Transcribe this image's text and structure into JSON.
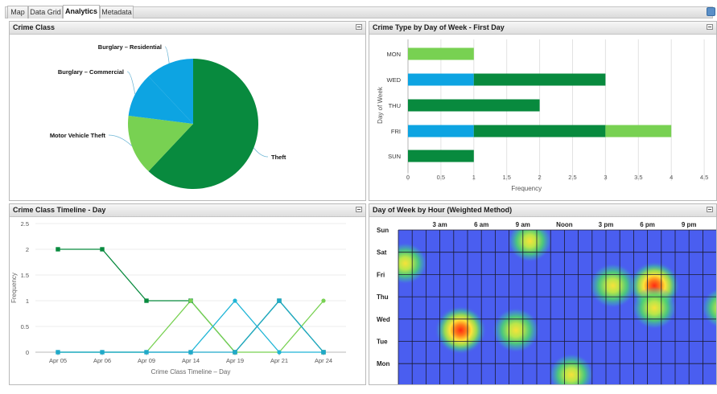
{
  "tabs": [
    {
      "label": "Map"
    },
    {
      "label": "Data Grid"
    },
    {
      "label": "Analytics"
    },
    {
      "label": "Metadata"
    }
  ],
  "panels": {
    "crime_class": {
      "title": "Crime Class"
    },
    "crime_type_day": {
      "title": "Crime Type by Day of Week - First Day"
    },
    "timeline": {
      "title": "Crime Class Timeline - Day"
    },
    "heatmap": {
      "title": "Day of Week by Hour (Weighted Method)"
    }
  },
  "colors": {
    "theft": "#088a3e",
    "motor_vehicle_theft": "#78d152",
    "burglary_commercial": "#0da4e2",
    "burglary_residential": "#0da4e2",
    "light_blue": "#1fb5d6"
  },
  "chart_data": [
    {
      "type": "pie",
      "slices": [
        {
          "label": "Theft",
          "value": 62,
          "color": "#088a3e"
        },
        {
          "label": "Motor Vehicle Theft",
          "value": 15,
          "color": "#78d152"
        },
        {
          "label": "Burglary – Commercial",
          "value": 11,
          "color": "#0da4e2"
        },
        {
          "label": "Burglary – Residential",
          "value": 12,
          "color": "#0da4e2"
        }
      ]
    },
    {
      "type": "bar",
      "orientation": "horizontal",
      "stacked": true,
      "categories": [
        "MON",
        "WED",
        "THU",
        "FRI",
        "SUN"
      ],
      "series": [
        {
          "values": [
            0,
            1,
            0,
            1,
            0
          ],
          "color": "#0da4e2"
        },
        {
          "values": [
            0,
            2,
            2,
            2,
            1
          ],
          "color": "#088a3e"
        },
        {
          "values": [
            1,
            0,
            0,
            1,
            0
          ],
          "color": "#78d152"
        }
      ],
      "xlabel": "Frequency",
      "ylabel": "Day of Week",
      "xlim": [
        0,
        4.5
      ],
      "xticks": [
        "0",
        "0.5",
        "1",
        "1.5",
        "2",
        "2.5",
        "3",
        "3.5",
        "4",
        "4.5"
      ],
      "grid": true
    },
    {
      "type": "line",
      "categories": [
        "Apr 05",
        "Apr 06",
        "Apr 09",
        "Apr 14",
        "Apr 19",
        "Apr 21",
        "Apr 24"
      ],
      "series": [
        {
          "values": [
            2,
            2,
            1,
            1,
            0,
            1,
            0
          ],
          "color": "#088a3e",
          "marker": "square"
        },
        {
          "values": [
            0,
            0,
            0,
            1,
            0,
            0,
            1
          ],
          "color": "#78d152",
          "marker": "circle"
        },
        {
          "values": [
            0,
            0,
            0,
            0,
            1,
            0,
            0
          ],
          "color": "#1fb5d6",
          "marker": "circle"
        },
        {
          "values": [
            0,
            0,
            0,
            0,
            0,
            1,
            0
          ],
          "color": "#1fa9c9",
          "marker": "square"
        }
      ],
      "xlabel": "Crime Class Timeline – Day",
      "ylabel": "Frequency",
      "ylim": [
        0,
        2.5
      ],
      "yticks": [
        "0",
        "0.5",
        "1",
        "1.5",
        "2",
        "2.5"
      ],
      "grid": true
    },
    {
      "type": "heatmap",
      "rows": [
        "Sun",
        "Sat",
        "Fri",
        "Thu",
        "Wed",
        "Tue",
        "Mon"
      ],
      "hour_labels": [
        "3 am",
        "6 am",
        "9 am",
        "Noon",
        "3 pm",
        "6 pm",
        "9 pm"
      ],
      "hot_spots": [
        {
          "day": "Sun",
          "hour": 9,
          "intensity": 0.55
        },
        {
          "day": "Sat",
          "hour": 0,
          "intensity": 0.55
        },
        {
          "day": "Fri",
          "hour": 15,
          "intensity": 0.75
        },
        {
          "day": "Fri",
          "hour": 18,
          "intensity": 1.0
        },
        {
          "day": "Thu",
          "hour": 18,
          "intensity": 0.6
        },
        {
          "day": "Thu",
          "hour": 23,
          "intensity": 0.55
        },
        {
          "day": "Wed",
          "hour": 4,
          "intensity": 1.0
        },
        {
          "day": "Wed",
          "hour": 8,
          "intensity": 0.75
        },
        {
          "day": "Mon",
          "hour": 12,
          "intensity": 0.6
        }
      ]
    }
  ]
}
